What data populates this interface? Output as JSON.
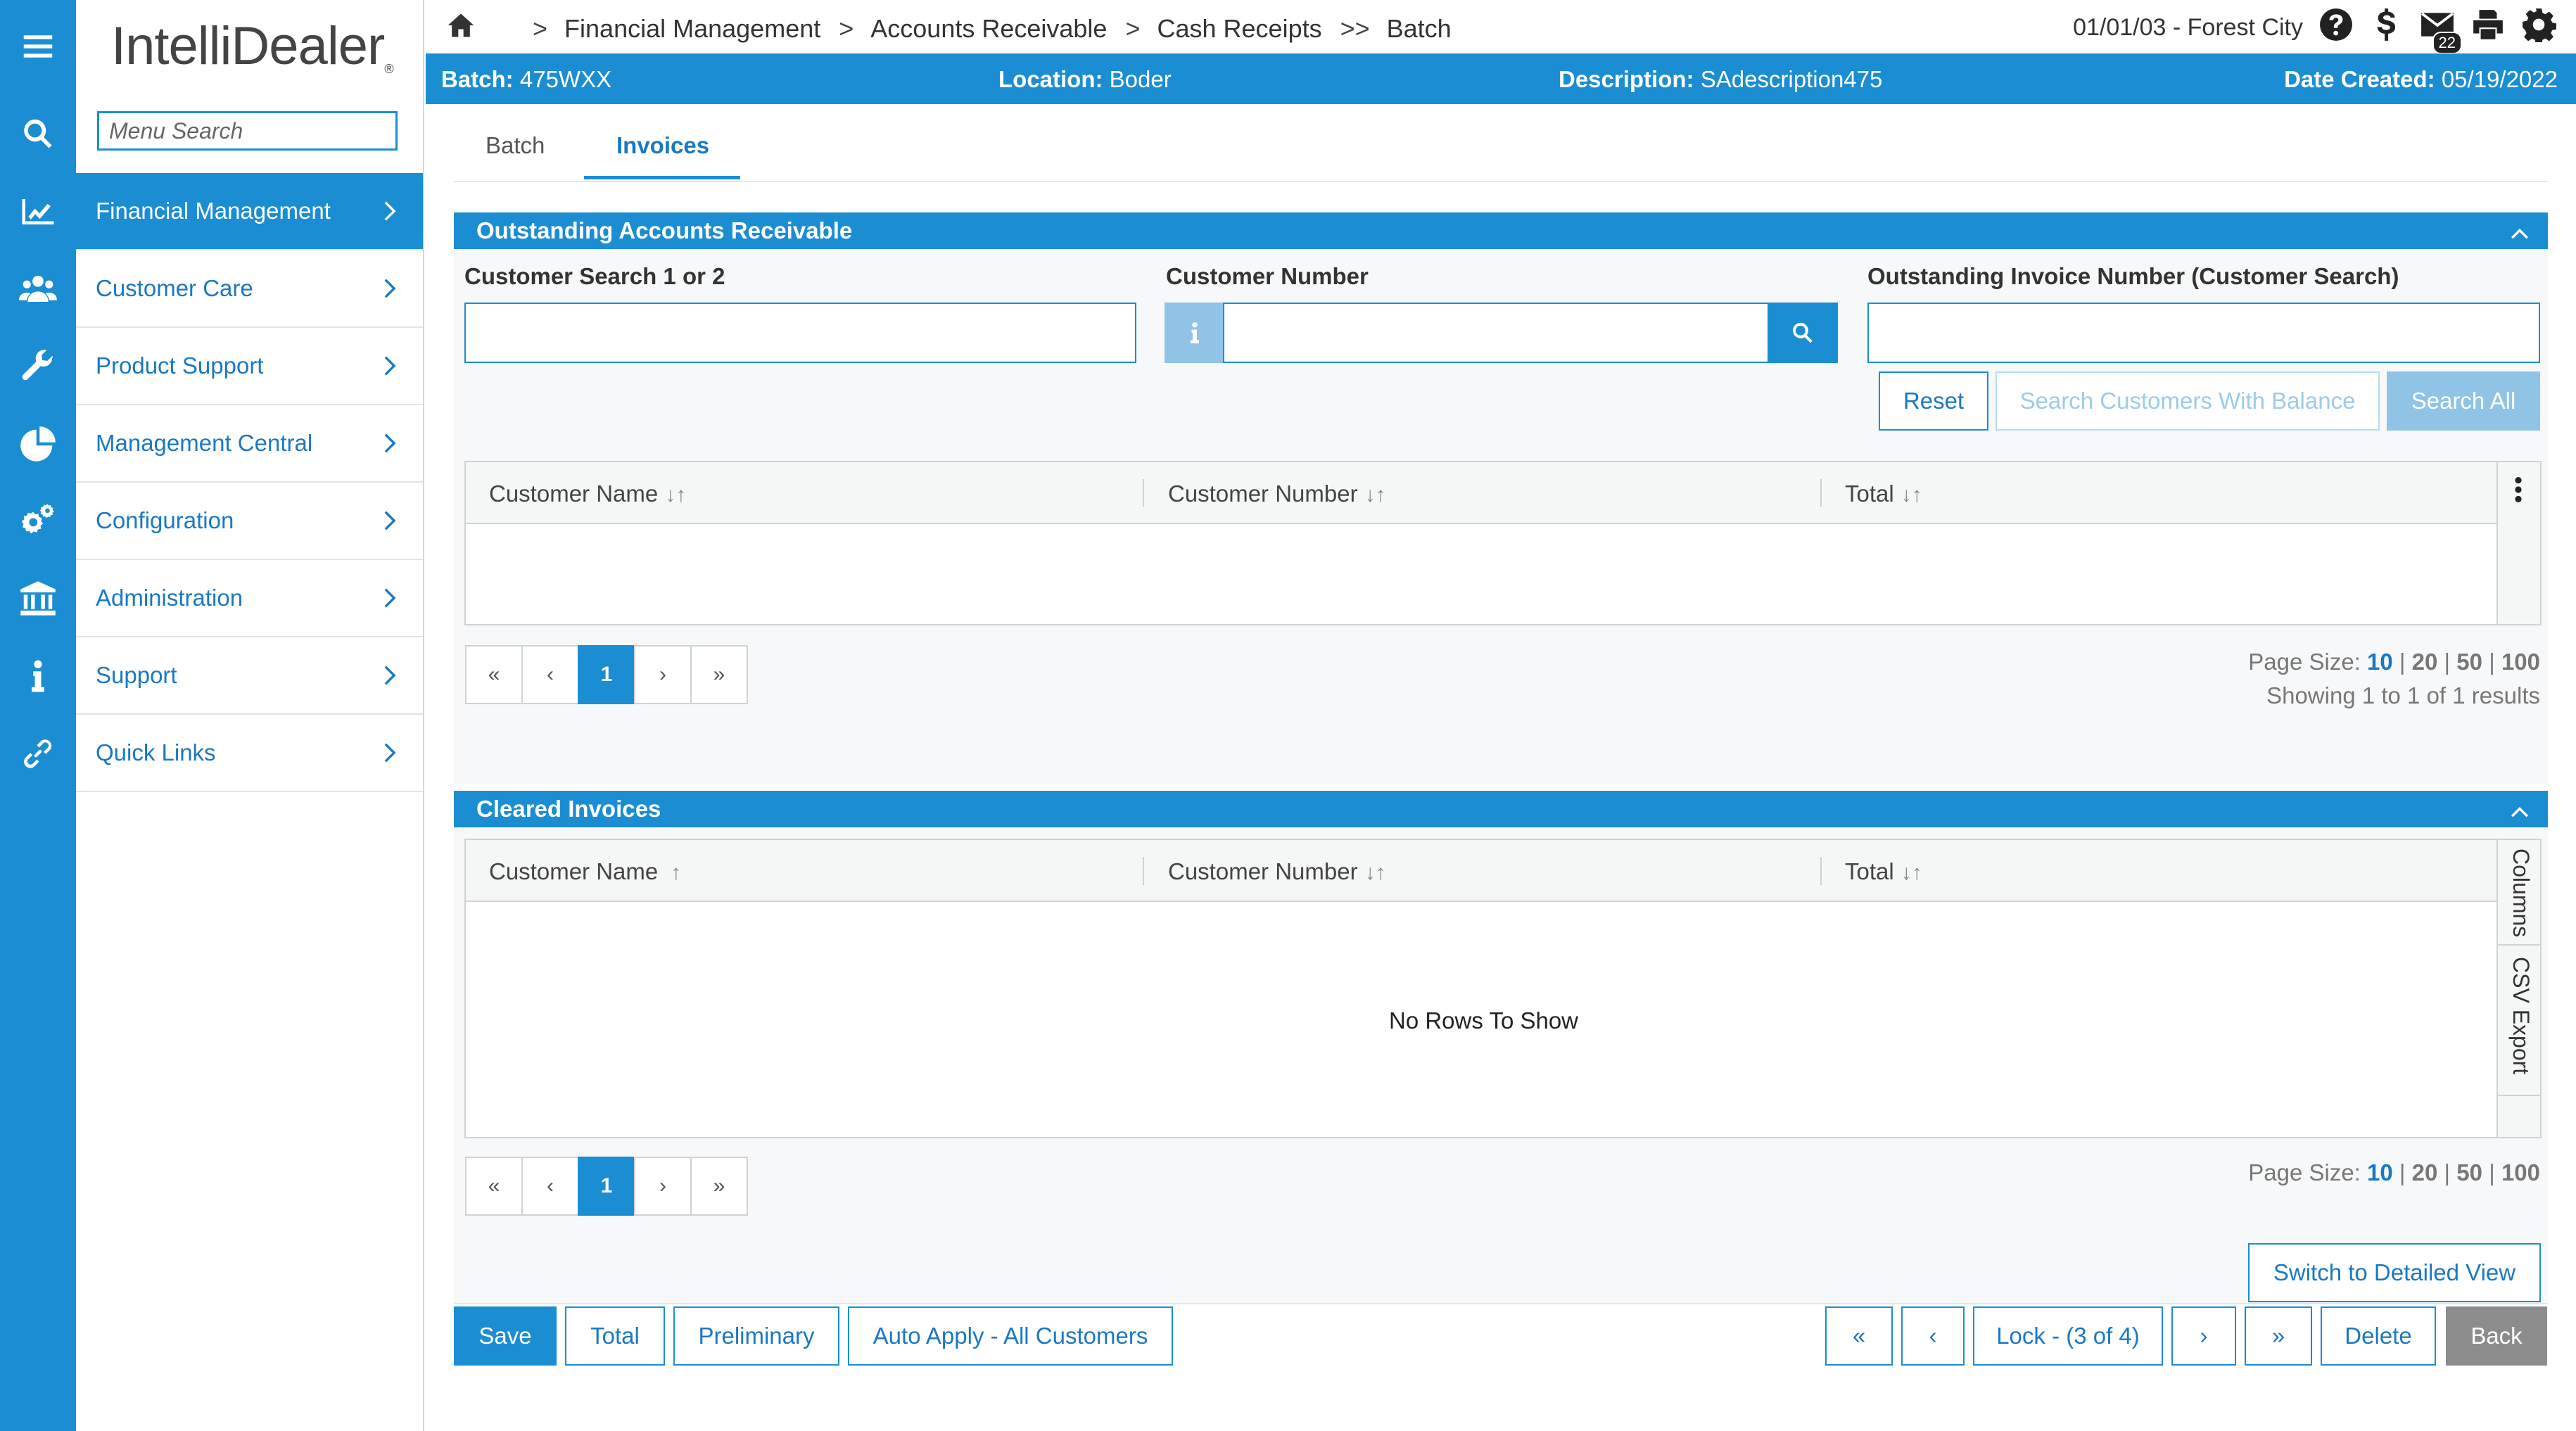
{
  "app": {
    "logo": "IntelliDealer",
    "logo_mark": "®"
  },
  "rail_icons": [
    "menu-icon",
    "search-icon",
    "chart-line-icon",
    "users-icon",
    "wrench-icon",
    "pie-chart-icon",
    "gears-icon",
    "bank-icon",
    "info-icon",
    "link-icon"
  ],
  "sidebar": {
    "search_placeholder": "Menu Search",
    "items": [
      {
        "label": "Financial Management",
        "active": true
      },
      {
        "label": "Customer Care"
      },
      {
        "label": "Product Support"
      },
      {
        "label": "Management Central"
      },
      {
        "label": "Configuration"
      },
      {
        "label": "Administration"
      },
      {
        "label": "Support"
      },
      {
        "label": "Quick Links"
      }
    ]
  },
  "breadcrumb": {
    "sep1": ">",
    "item1": "Financial Management",
    "sep2": ">",
    "item2": "Accounts Receivable",
    "sep3": ">",
    "item3": "Cash Receipts",
    "sep4": ">>",
    "item4": "Batch"
  },
  "header": {
    "date_location": "01/01/03 - Forest City",
    "mail_count": "22",
    "icons": [
      "help-icon",
      "dollar-icon",
      "mail-icon",
      "print-icon",
      "settings-icon"
    ]
  },
  "batch_bar": {
    "batch_label": "Batch:",
    "batch_value": "475WXX",
    "location_label": "Location:",
    "location_value": "Boder",
    "description_label": "Description:",
    "description_value": "SAdescription475",
    "date_label": "Date Created:",
    "date_value": "05/19/2022"
  },
  "tabs": {
    "batch": "Batch",
    "invoices": "Invoices",
    "active": "Invoices"
  },
  "outstanding": {
    "title": "Outstanding Accounts Receivable",
    "search1_label": "Customer Search 1 or 2",
    "search1_value": "",
    "custnum_label": "Customer Number",
    "custnum_value": "",
    "invoice_label": "Outstanding Invoice Number (Customer Search)",
    "invoice_value": "",
    "reset_label": "Reset",
    "search_balance_label": "Search Customers With Balance",
    "search_all_label": "Search All",
    "columns": {
      "name": "Customer Name",
      "number": "Customer Number",
      "total": "Total"
    },
    "sort_glyph": "↓↑",
    "rows": [],
    "pager": {
      "first": "«",
      "prev": "‹",
      "current": "1",
      "next": "›",
      "last": "»"
    },
    "page_size_label": "Page Size:",
    "page_sizes": [
      "10",
      "20",
      "50",
      "100"
    ],
    "page_size_sep": "|",
    "showing": "Showing 1 to 1 of 1 results"
  },
  "cleared": {
    "title": "Cleared Invoices",
    "columns": {
      "name": "Customer Name",
      "number": "Customer Number",
      "total": "Total"
    },
    "name_sort_glyph": "↑",
    "sort_glyph": "↓↑",
    "empty_message": "No Rows To Show",
    "side_tabs": {
      "columns": "Columns",
      "csv": "CSV Export"
    },
    "pager": {
      "first": "«",
      "prev": "‹",
      "current": "1",
      "next": "›",
      "last": "»"
    },
    "page_size_label": "Page Size:",
    "page_sizes": [
      "10",
      "20",
      "50",
      "100"
    ],
    "page_size_sep": "|",
    "switch_view_label": "Switch to Detailed View"
  },
  "actions": {
    "save": "Save",
    "total": "Total",
    "preliminary": "Preliminary",
    "auto_apply": "Auto Apply - All Customers",
    "first": "«",
    "prev": "‹",
    "lock": "Lock - (3 of 4)",
    "next": "›",
    "last": "»",
    "delete": "Delete",
    "back": "Back"
  },
  "colors": {
    "accent": "#1b8dd3",
    "accent_light": "#8fc4e6",
    "link": "#1b78c4",
    "grey_button": "#8c8c8c"
  }
}
